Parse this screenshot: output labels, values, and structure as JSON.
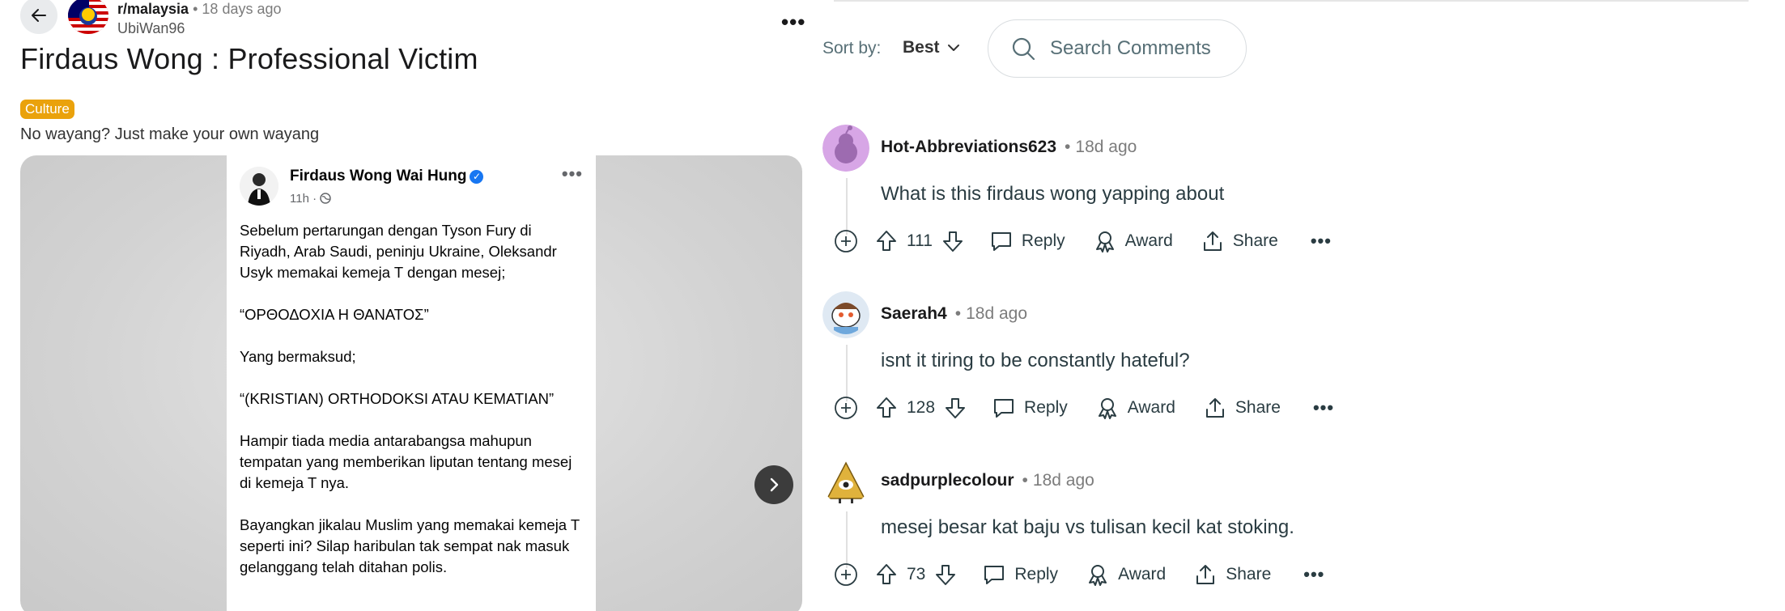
{
  "post": {
    "subreddit": "r/malaysia",
    "dot": "•",
    "age": "18 days ago",
    "author": "UbiWan96",
    "title": "Firdaus Wong : Professional Victim",
    "flair": "Culture",
    "body": "No wayang? Just make your own wayang",
    "image": {
      "fb_name": "Firdaus Wong Wai Hung",
      "fb_time": "11h ·",
      "paragraphs": [
        "Sebelum pertarungan dengan Tyson Fury di Riyadh, Arab Saudi, peninju Ukraine, Oleksandr Usyk memakai kemeja T dengan mesej;",
        "“ΟΡΘΟΔΟΧΙΑ Η ΘΑΝΑΤΟΣ”",
        "Yang bermaksud;",
        "“(KRISTIAN) ORTHODOKSI ATAU KEMATIAN”",
        "Hampir tiada media antarabangsa mahupun tempatan yang memberikan liputan tentang mesej di kemeja T nya.",
        "Bayangkan jikalau Muslim yang memakai kemeja T seperti ini? Silap haribulan tak sempat nak masuk gelanggang telah ditahan polis."
      ]
    }
  },
  "comments_header": {
    "sort_label": "Sort by:",
    "sort_value": "Best",
    "search_placeholder": "Search Comments"
  },
  "comments": [
    {
      "user": "Hot-Abbreviations623",
      "dot": "•",
      "age": "18d ago",
      "text": "What is this firdaus wong yapping about",
      "votes": "111",
      "reply": "Reply",
      "award": "Award",
      "share": "Share",
      "avatar_color": "#c98ed9"
    },
    {
      "user": "Saerah4",
      "dot": "•",
      "age": "18d ago",
      "text": "isnt it tiring to be constantly hateful?",
      "votes": "128",
      "reply": "Reply",
      "award": "Award",
      "share": "Share",
      "avatar_color": "#9ec9e8"
    },
    {
      "user": "sadpurplecolour",
      "dot": "•",
      "age": "18d ago",
      "text": "mesej besar kat baju vs tulisan kecil kat stoking.",
      "votes": "73",
      "reply": "Reply",
      "award": "Award",
      "share": "Share",
      "avatar_color": "#e0b23c"
    }
  ]
}
